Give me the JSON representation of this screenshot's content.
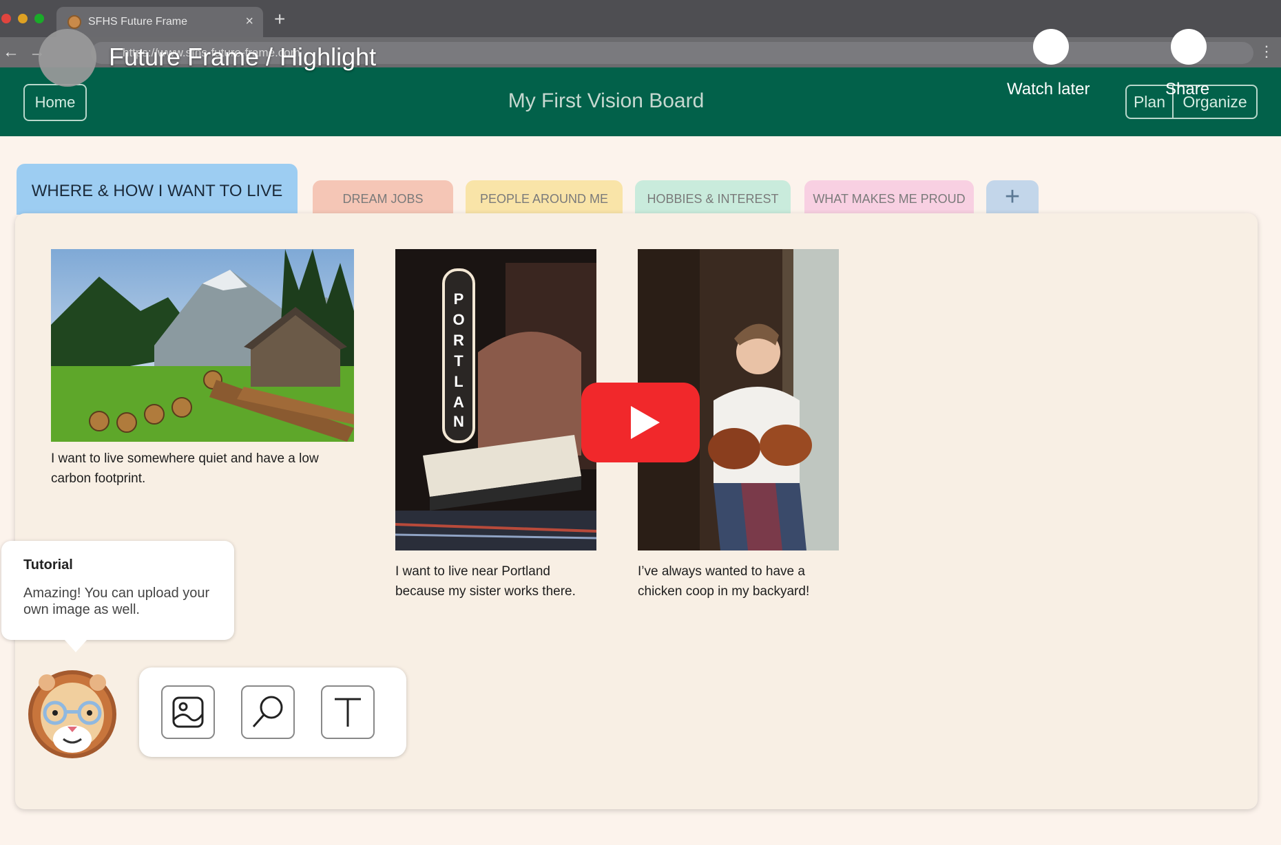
{
  "browser": {
    "tab_title": "SFHS Future Frame",
    "tab_close": "×",
    "new_tab": "+",
    "back": "←",
    "forward": "→",
    "url": "https://www.sfhs-future-frame.com",
    "menu": "⋮"
  },
  "video_overlay": {
    "title": "Future Frame / Highlight",
    "watch_later_label": "Watch later",
    "share_label": "Share"
  },
  "header": {
    "home_label": "Home",
    "board_title": "My First Vision Board",
    "plan_label": "Plan",
    "organize_label": "Organize"
  },
  "category_tabs": [
    {
      "label": "WHERE & HOW I WANT TO LIVE",
      "active": true
    },
    {
      "label": "DREAM JOBS",
      "active": false
    },
    {
      "label": "PEOPLE AROUND ME",
      "active": false
    },
    {
      "label": "HOBBIES & INTEREST",
      "active": false
    },
    {
      "label": "WHAT MAKES ME PROUD",
      "active": false
    },
    {
      "label": "+",
      "active": false
    }
  ],
  "cards": [
    {
      "image": "mountain-cabin-photo",
      "caption": "I want to live somewhere quiet and have a low carbon footprint."
    },
    {
      "image": "portland-theater-sign-photo",
      "caption": "I want to live near Portland because my sister works there."
    },
    {
      "image": "woman-holding-chickens-photo",
      "caption": "I’ve always wanted to have a chicken coop in my backyard!"
    }
  ],
  "tutorial": {
    "title": "Tutorial",
    "body": "Amazing! You can upload your own image as well."
  },
  "tools": [
    "upload-image-icon",
    "search-icon",
    "text-icon"
  ],
  "colors": {
    "header_green": "#02614a",
    "active_tab_blue": "#9dcdf2",
    "youtube_red": "#f1282b",
    "board_bg": "#f8efe4"
  }
}
